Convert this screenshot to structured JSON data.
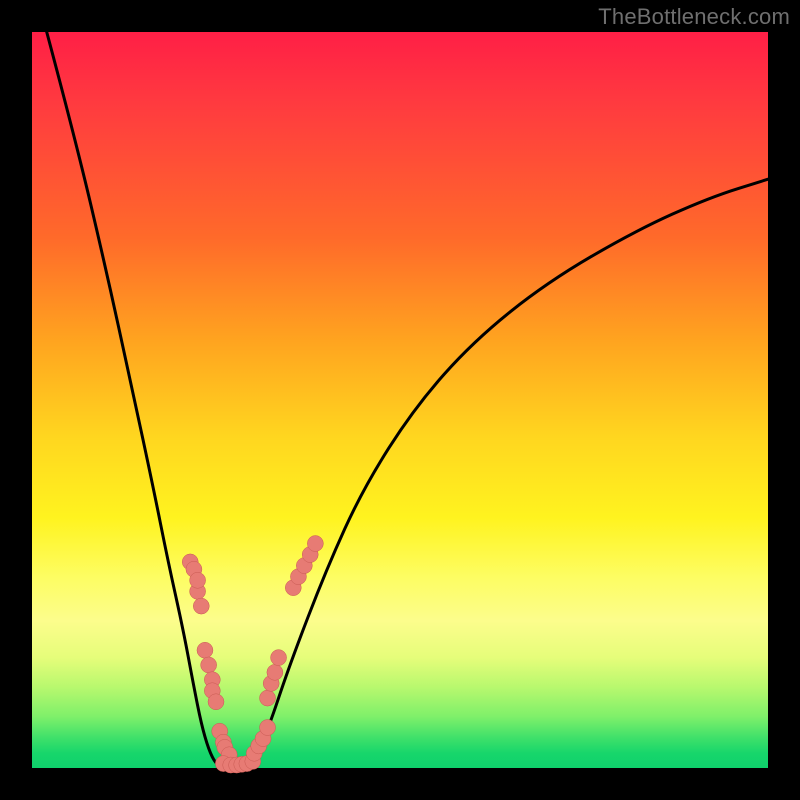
{
  "watermark": {
    "text": "TheBottleneck.com"
  },
  "colors": {
    "curve": "#000000",
    "dot_fill": "#e77b74",
    "dot_stroke": "#c95a53",
    "gradient_stops": [
      "#ff1f46",
      "#ff6a2a",
      "#ffd61f",
      "#fcfd8c",
      "#3de06a",
      "#0fd16c"
    ]
  },
  "chart_data": {
    "type": "line",
    "title": "",
    "xlabel": "",
    "ylabel": "",
    "xlim": [
      0,
      100
    ],
    "ylim": [
      0,
      100
    ],
    "series": [
      {
        "name": "left-branch",
        "x": [
          2,
          6,
          10,
          13.5,
          16.5,
          18.5,
          20.5,
          22,
          23,
          24,
          25
        ],
        "y": [
          100,
          85,
          68,
          52,
          38,
          28,
          19,
          11,
          6,
          2.5,
          0.5
        ]
      },
      {
        "name": "valley-floor",
        "x": [
          25,
          26,
          27,
          28,
          29,
          30
        ],
        "y": [
          0.5,
          0.2,
          0.2,
          0.2,
          0.3,
          0.8
        ]
      },
      {
        "name": "right-branch",
        "x": [
          30,
          32,
          35,
          40,
          45,
          52,
          60,
          70,
          82,
          92,
          100
        ],
        "y": [
          0.8,
          5,
          14,
          27,
          38,
          49,
          58,
          66,
          73,
          77.5,
          80
        ]
      }
    ],
    "scatter": [
      {
        "name": "dots-left-upper",
        "x": [
          21.5,
          22.0,
          22.5,
          22.5,
          23.0
        ],
        "y": [
          28.0,
          27.0,
          24.0,
          25.5,
          22.0
        ]
      },
      {
        "name": "dots-left-mid",
        "x": [
          23.5,
          24.0,
          24.5,
          24.5,
          25.0
        ],
        "y": [
          16.0,
          14.0,
          12.0,
          10.5,
          9.0
        ]
      },
      {
        "name": "dots-left-low",
        "x": [
          25.5,
          26.0,
          26.2,
          26.8
        ],
        "y": [
          5.0,
          3.5,
          2.8,
          1.8
        ]
      },
      {
        "name": "dots-floor",
        "x": [
          26.0,
          27.0,
          27.8,
          28.5,
          29.2,
          30.0
        ],
        "y": [
          0.6,
          0.4,
          0.4,
          0.5,
          0.6,
          0.9
        ]
      },
      {
        "name": "dots-right-low",
        "x": [
          30.2,
          30.8,
          31.4,
          32.0
        ],
        "y": [
          2.0,
          3.0,
          4.0,
          5.5
        ]
      },
      {
        "name": "dots-right-mid",
        "x": [
          32.0,
          32.5,
          33.0,
          33.5
        ],
        "y": [
          9.5,
          11.5,
          13.0,
          15.0
        ]
      },
      {
        "name": "dots-right-upper",
        "x": [
          35.5,
          36.2,
          37.0,
          37.8,
          38.5
        ],
        "y": [
          24.5,
          26.0,
          27.5,
          29.0,
          30.5
        ]
      }
    ]
  }
}
